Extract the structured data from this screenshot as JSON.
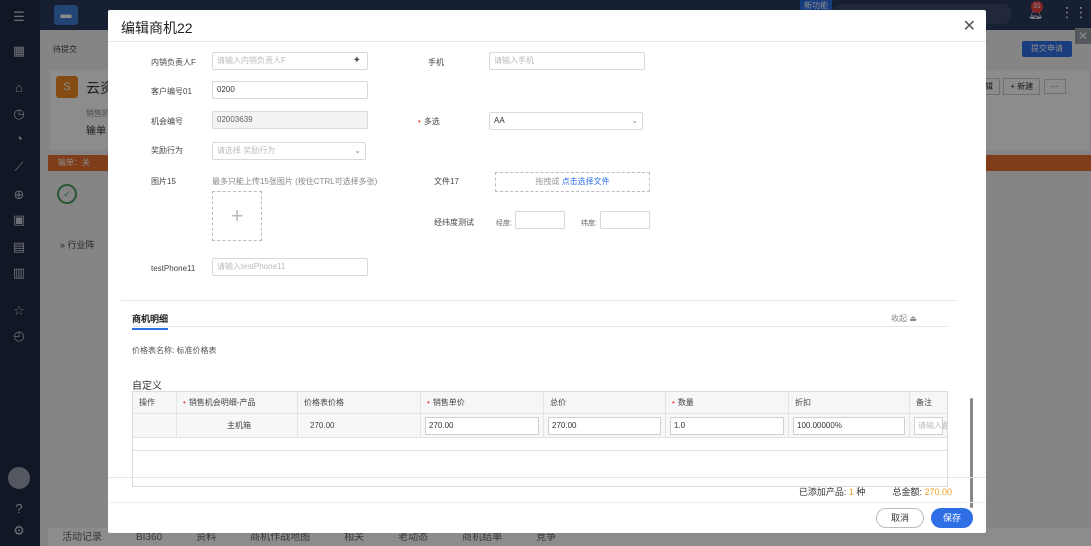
{
  "background": {
    "pending_label": "待提交",
    "new_badge": "新功能",
    "bell_count": "31",
    "submit_request": "提交申请",
    "record_initial": "S",
    "record_name": "云资",
    "record_label": "销售阶",
    "record_value": "输单",
    "more_label": "辑",
    "new_button": "+ 新建",
    "more_button": "···",
    "strip_label": "输单：关",
    "industry_label": "行业阵",
    "bottom_tabs": [
      "活动记录",
      "BI360",
      "资料",
      "商机作战地图",
      "相关",
      "老动态",
      "商机结单",
      "竞争"
    ]
  },
  "modal": {
    "title": "编辑商机22",
    "fields_left": [
      {
        "label": "内销负责人F",
        "placeholder": "请输入内销负责人F",
        "value": "",
        "type": "lookup"
      },
      {
        "label": "客户编号01",
        "placeholder": "",
        "value": "0200",
        "type": "text"
      },
      {
        "label": "机会编号",
        "placeholder": "",
        "value": "02003639",
        "type": "disabled"
      },
      {
        "label": "奖励行为",
        "placeholder": "请选择 奖励行为",
        "value": "",
        "type": "select"
      }
    ],
    "phone_label": "手机",
    "phone_placeholder": "请输入手机",
    "multi_label": "多选",
    "multi_value": "AA",
    "image_label": "图片15",
    "image_hint": "最多只能上传15张图片 (按住CTRL可选择多张)",
    "file_label": "文件17",
    "file_drop_text": "拖拽或",
    "file_drop_link": "点击选择文件",
    "geo_label": "经纬度测试",
    "longitude_label": "经度:",
    "latitude_label": "纬度:",
    "testphone_label": "testPhone11",
    "testphone_placeholder": "请输入testPhone11"
  },
  "details": {
    "section_title": "商机明细",
    "collapse_label": "收起",
    "price_table": "价格表名称: 标准价格表",
    "custom_label": "自定义",
    "columns": [
      {
        "label": "操作",
        "required": false
      },
      {
        "label": "销售机会明细-产品",
        "required": true
      },
      {
        "label": "价格表价格",
        "required": false
      },
      {
        "label": "销售单价",
        "required": true
      },
      {
        "label": "总价",
        "required": false
      },
      {
        "label": "数量",
        "required": true
      },
      {
        "label": "折扣",
        "required": false
      },
      {
        "label": "备注",
        "required": false
      }
    ],
    "row": {
      "product": "主机箱",
      "list_price": "270.00",
      "unit_price": "270.00",
      "total": "270.00",
      "quantity": "1.0",
      "discount": "100.00000%",
      "remark_placeholder": "请输入备注"
    }
  },
  "footer": {
    "added_label": "已添加产品:",
    "added_count": "1",
    "added_unit": "种",
    "total_label": "总金额:",
    "total_value": "270.00",
    "cancel": "取消",
    "save": "保存"
  },
  "colors": {
    "primary": "#2f6fe6",
    "required": "#e5483f",
    "highlight": "#f0a020"
  }
}
